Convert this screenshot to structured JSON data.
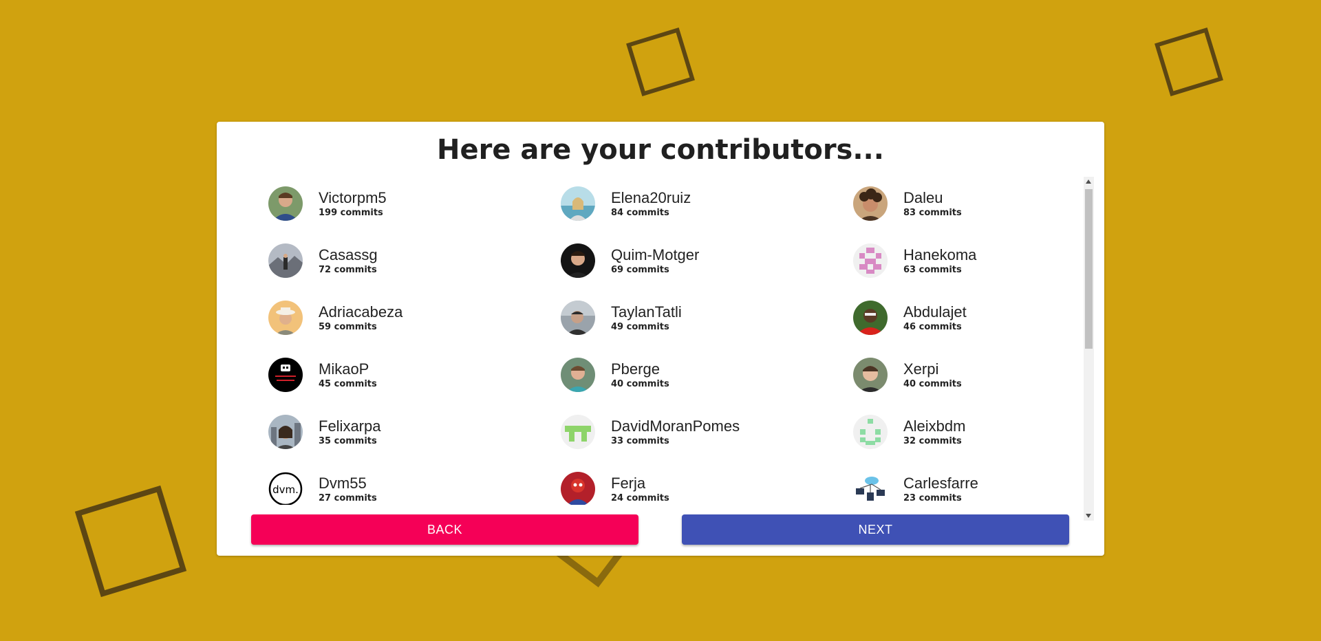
{
  "title": "Here are your contributors...",
  "contributors": [
    {
      "name": "Victorpm5",
      "commits": "199 commits",
      "avatar": "photo-man-blue"
    },
    {
      "name": "Elena20ruiz",
      "commits": "84 commits",
      "avatar": "photo-beach"
    },
    {
      "name": "Daleu",
      "commits": "83 commits",
      "avatar": "photo-curly-hair"
    },
    {
      "name": "Casassg",
      "commits": "72 commits",
      "avatar": "photo-mountain"
    },
    {
      "name": "Quim-Motger",
      "commits": "69 commits",
      "avatar": "photo-man-dark"
    },
    {
      "name": "Hanekoma",
      "commits": "63 commits",
      "avatar": "identicon-pink"
    },
    {
      "name": "Adriacabeza",
      "commits": "59 commits",
      "avatar": "photo-sunset-hat"
    },
    {
      "name": "TaylanTatli",
      "commits": "49 commits",
      "avatar": "photo-grey"
    },
    {
      "name": "Abdulajet",
      "commits": "46 commits",
      "avatar": "photo-red-shirt"
    },
    {
      "name": "MikaoP",
      "commits": "45 commits",
      "avatar": "logo-black-red"
    },
    {
      "name": "Pberge",
      "commits": "40 commits",
      "avatar": "photo-green"
    },
    {
      "name": "Xerpi",
      "commits": "40 commits",
      "avatar": "photo-boy"
    },
    {
      "name": "Felixarpa",
      "commits": "35 commits",
      "avatar": "photo-city"
    },
    {
      "name": "DavidMoranPomes",
      "commits": "33 commits",
      "avatar": "identicon-green"
    },
    {
      "name": "Aleixbdm",
      "commits": "32 commits",
      "avatar": "identicon-mint"
    },
    {
      "name": "Dvm55",
      "commits": "27 commits",
      "avatar": "logo-dvm"
    },
    {
      "name": "Ferja",
      "commits": "24 commits",
      "avatar": "photo-spiderman"
    },
    {
      "name": "Carlesfarre",
      "commits": "23 commits",
      "avatar": "icon-network"
    }
  ],
  "buttons": {
    "back": "BACK",
    "next": "NEXT"
  },
  "colors": {
    "background": "#d0a20f",
    "back_button": "#f50057",
    "next_button": "#3f51b5",
    "decor_square": "#5c4613"
  }
}
